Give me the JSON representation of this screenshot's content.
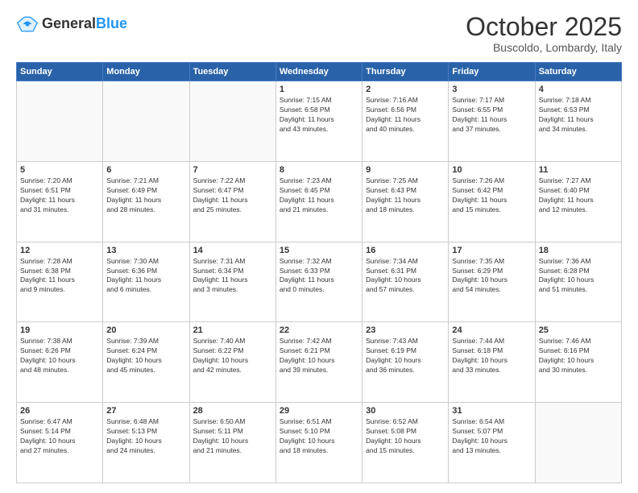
{
  "header": {
    "logo_general": "General",
    "logo_blue": "Blue",
    "month": "October 2025",
    "location": "Buscoldo, Lombardy, Italy"
  },
  "days_of_week": [
    "Sunday",
    "Monday",
    "Tuesday",
    "Wednesday",
    "Thursday",
    "Friday",
    "Saturday"
  ],
  "weeks": [
    [
      {
        "day": "",
        "info": ""
      },
      {
        "day": "",
        "info": ""
      },
      {
        "day": "",
        "info": ""
      },
      {
        "day": "1",
        "info": "Sunrise: 7:15 AM\nSunset: 6:58 PM\nDaylight: 11 hours\nand 43 minutes."
      },
      {
        "day": "2",
        "info": "Sunrise: 7:16 AM\nSunset: 6:56 PM\nDaylight: 11 hours\nand 40 minutes."
      },
      {
        "day": "3",
        "info": "Sunrise: 7:17 AM\nSunset: 6:55 PM\nDaylight: 11 hours\nand 37 minutes."
      },
      {
        "day": "4",
        "info": "Sunrise: 7:18 AM\nSunset: 6:53 PM\nDaylight: 11 hours\nand 34 minutes."
      }
    ],
    [
      {
        "day": "5",
        "info": "Sunrise: 7:20 AM\nSunset: 6:51 PM\nDaylight: 11 hours\nand 31 minutes."
      },
      {
        "day": "6",
        "info": "Sunrise: 7:21 AM\nSunset: 6:49 PM\nDaylight: 11 hours\nand 28 minutes."
      },
      {
        "day": "7",
        "info": "Sunrise: 7:22 AM\nSunset: 6:47 PM\nDaylight: 11 hours\nand 25 minutes."
      },
      {
        "day": "8",
        "info": "Sunrise: 7:23 AM\nSunset: 6:45 PM\nDaylight: 11 hours\nand 21 minutes."
      },
      {
        "day": "9",
        "info": "Sunrise: 7:25 AM\nSunset: 6:43 PM\nDaylight: 11 hours\nand 18 minutes."
      },
      {
        "day": "10",
        "info": "Sunrise: 7:26 AM\nSunset: 6:42 PM\nDaylight: 11 hours\nand 15 minutes."
      },
      {
        "day": "11",
        "info": "Sunrise: 7:27 AM\nSunset: 6:40 PM\nDaylight: 11 hours\nand 12 minutes."
      }
    ],
    [
      {
        "day": "12",
        "info": "Sunrise: 7:28 AM\nSunset: 6:38 PM\nDaylight: 11 hours\nand 9 minutes."
      },
      {
        "day": "13",
        "info": "Sunrise: 7:30 AM\nSunset: 6:36 PM\nDaylight: 11 hours\nand 6 minutes."
      },
      {
        "day": "14",
        "info": "Sunrise: 7:31 AM\nSunset: 6:34 PM\nDaylight: 11 hours\nand 3 minutes."
      },
      {
        "day": "15",
        "info": "Sunrise: 7:32 AM\nSunset: 6:33 PM\nDaylight: 11 hours\nand 0 minutes."
      },
      {
        "day": "16",
        "info": "Sunrise: 7:34 AM\nSunset: 6:31 PM\nDaylight: 10 hours\nand 57 minutes."
      },
      {
        "day": "17",
        "info": "Sunrise: 7:35 AM\nSunset: 6:29 PM\nDaylight: 10 hours\nand 54 minutes."
      },
      {
        "day": "18",
        "info": "Sunrise: 7:36 AM\nSunset: 6:28 PM\nDaylight: 10 hours\nand 51 minutes."
      }
    ],
    [
      {
        "day": "19",
        "info": "Sunrise: 7:38 AM\nSunset: 6:26 PM\nDaylight: 10 hours\nand 48 minutes."
      },
      {
        "day": "20",
        "info": "Sunrise: 7:39 AM\nSunset: 6:24 PM\nDaylight: 10 hours\nand 45 minutes."
      },
      {
        "day": "21",
        "info": "Sunrise: 7:40 AM\nSunset: 6:22 PM\nDaylight: 10 hours\nand 42 minutes."
      },
      {
        "day": "22",
        "info": "Sunrise: 7:42 AM\nSunset: 6:21 PM\nDaylight: 10 hours\nand 39 minutes."
      },
      {
        "day": "23",
        "info": "Sunrise: 7:43 AM\nSunset: 6:19 PM\nDaylight: 10 hours\nand 36 minutes."
      },
      {
        "day": "24",
        "info": "Sunrise: 7:44 AM\nSunset: 6:18 PM\nDaylight: 10 hours\nand 33 minutes."
      },
      {
        "day": "25",
        "info": "Sunrise: 7:46 AM\nSunset: 6:16 PM\nDaylight: 10 hours\nand 30 minutes."
      }
    ],
    [
      {
        "day": "26",
        "info": "Sunrise: 6:47 AM\nSunset: 5:14 PM\nDaylight: 10 hours\nand 27 minutes."
      },
      {
        "day": "27",
        "info": "Sunrise: 6:48 AM\nSunset: 5:13 PM\nDaylight: 10 hours\nand 24 minutes."
      },
      {
        "day": "28",
        "info": "Sunrise: 6:50 AM\nSunset: 5:11 PM\nDaylight: 10 hours\nand 21 minutes."
      },
      {
        "day": "29",
        "info": "Sunrise: 6:51 AM\nSunset: 5:10 PM\nDaylight: 10 hours\nand 18 minutes."
      },
      {
        "day": "30",
        "info": "Sunrise: 6:52 AM\nSunset: 5:08 PM\nDaylight: 10 hours\nand 15 minutes."
      },
      {
        "day": "31",
        "info": "Sunrise: 6:54 AM\nSunset: 5:07 PM\nDaylight: 10 hours\nand 13 minutes."
      },
      {
        "day": "",
        "info": ""
      }
    ]
  ]
}
